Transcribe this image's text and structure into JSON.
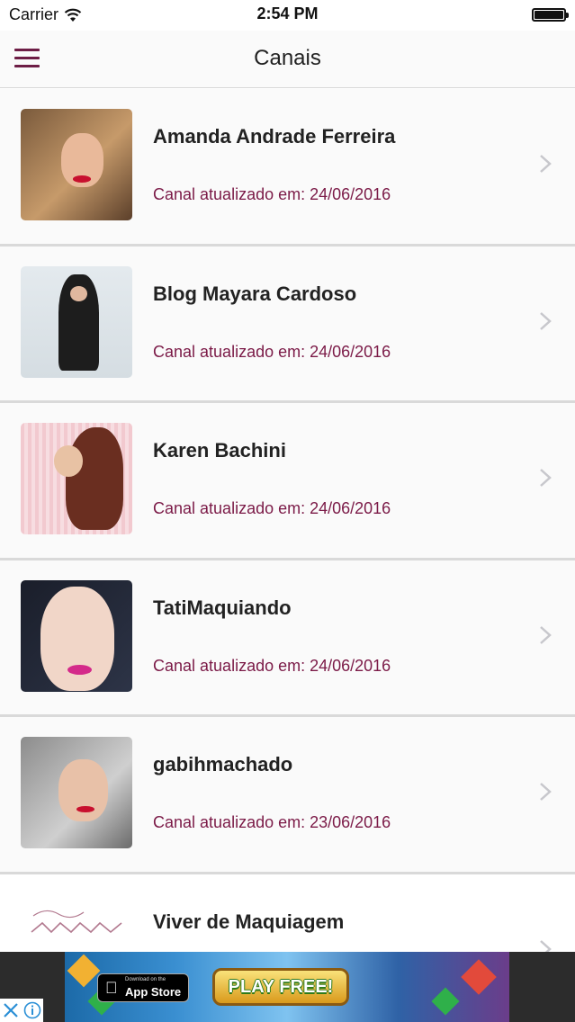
{
  "status_bar": {
    "carrier": "Carrier",
    "time": "2:54 PM"
  },
  "nav": {
    "title": "Canais",
    "accent_color": "#6d1d45"
  },
  "channels": [
    {
      "name": "Amanda Andrade Ferreira",
      "updated": "Canal atualizado em: 24/06/2016"
    },
    {
      "name": "Blog Mayara Cardoso",
      "updated": "Canal atualizado em: 24/06/2016"
    },
    {
      "name": "Karen Bachini",
      "updated": "Canal atualizado em: 24/06/2016"
    },
    {
      "name": "TatiMaquiando",
      "updated": "Canal atualizado em: 24/06/2016"
    },
    {
      "name": "gabihmachado",
      "updated": "Canal atualizado em: 23/06/2016"
    },
    {
      "name": "Viver de Maquiagem",
      "updated": ""
    }
  ],
  "ad": {
    "store_small": "Download on the",
    "store_big": "App Store",
    "cta": "PLAY FREE!"
  },
  "colors": {
    "subtitle": "#7b1a47",
    "separator": "#d9d9d9"
  }
}
